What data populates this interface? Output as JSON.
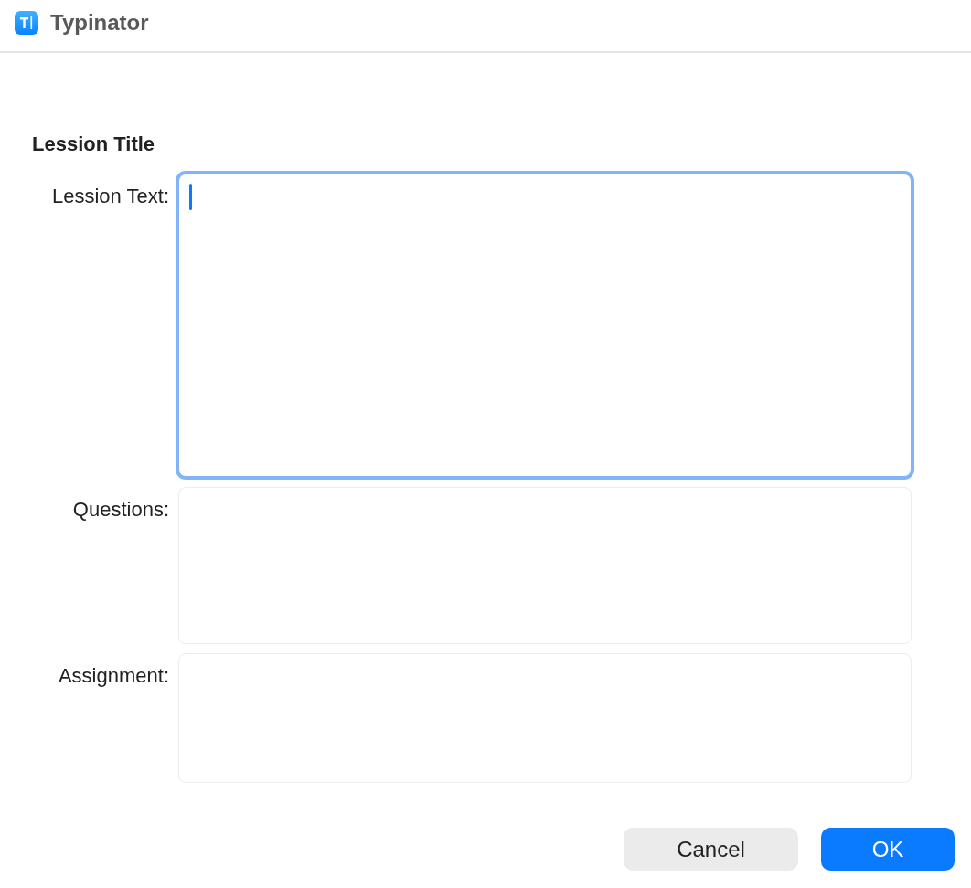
{
  "window": {
    "title": "Typinator"
  },
  "heading": "Lession Title",
  "fields": [
    {
      "label": "Lession Text:",
      "focused": true
    },
    {
      "label": "Questions:",
      "focused": false
    },
    {
      "label": "Assignment:",
      "focused": false
    }
  ],
  "buttons": [
    {
      "label": "Cancel",
      "kind": "secondary"
    },
    {
      "label": "OK",
      "kind": "primary"
    }
  ]
}
